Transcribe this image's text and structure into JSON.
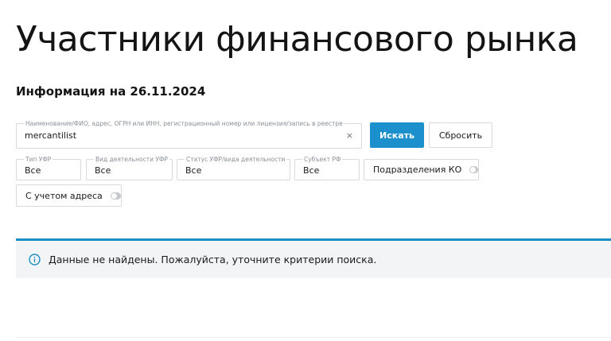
{
  "header": {
    "title": "Участники финансового рынка",
    "info_date": "Информация на 26.11.2024"
  },
  "search": {
    "label": "Наименование/ФИО, адрес, ОГРН или ИНН, регистрационный номер или лицензия/запись в реестре",
    "value": "mercantilist",
    "clear_icon": "×",
    "submit_label": "Искать",
    "reset_label": "Сбросить"
  },
  "filters": {
    "type": {
      "label": "Тип УФР",
      "value": "Все"
    },
    "activity": {
      "label": "Вид деятельности УФР",
      "value": "Все"
    },
    "status": {
      "label": "Статус УФР/вида деятельности",
      "value": "Все"
    },
    "region": {
      "label": "Субъект РФ",
      "value": "Все"
    },
    "ko_divisions": {
      "label": "Подразделения КО",
      "enabled": false
    },
    "with_address": {
      "label": "С учетом адреса",
      "enabled": false
    }
  },
  "notice": {
    "icon": "info-circle-icon",
    "text": "Данные не найдены. Пожалуйста, уточните критерии поиска."
  },
  "colors": {
    "accent": "#1c8fcd",
    "notice_border": "#1b8fc6",
    "notice_background": "#f3f4f5",
    "switch_off": "#c3c6ca"
  }
}
